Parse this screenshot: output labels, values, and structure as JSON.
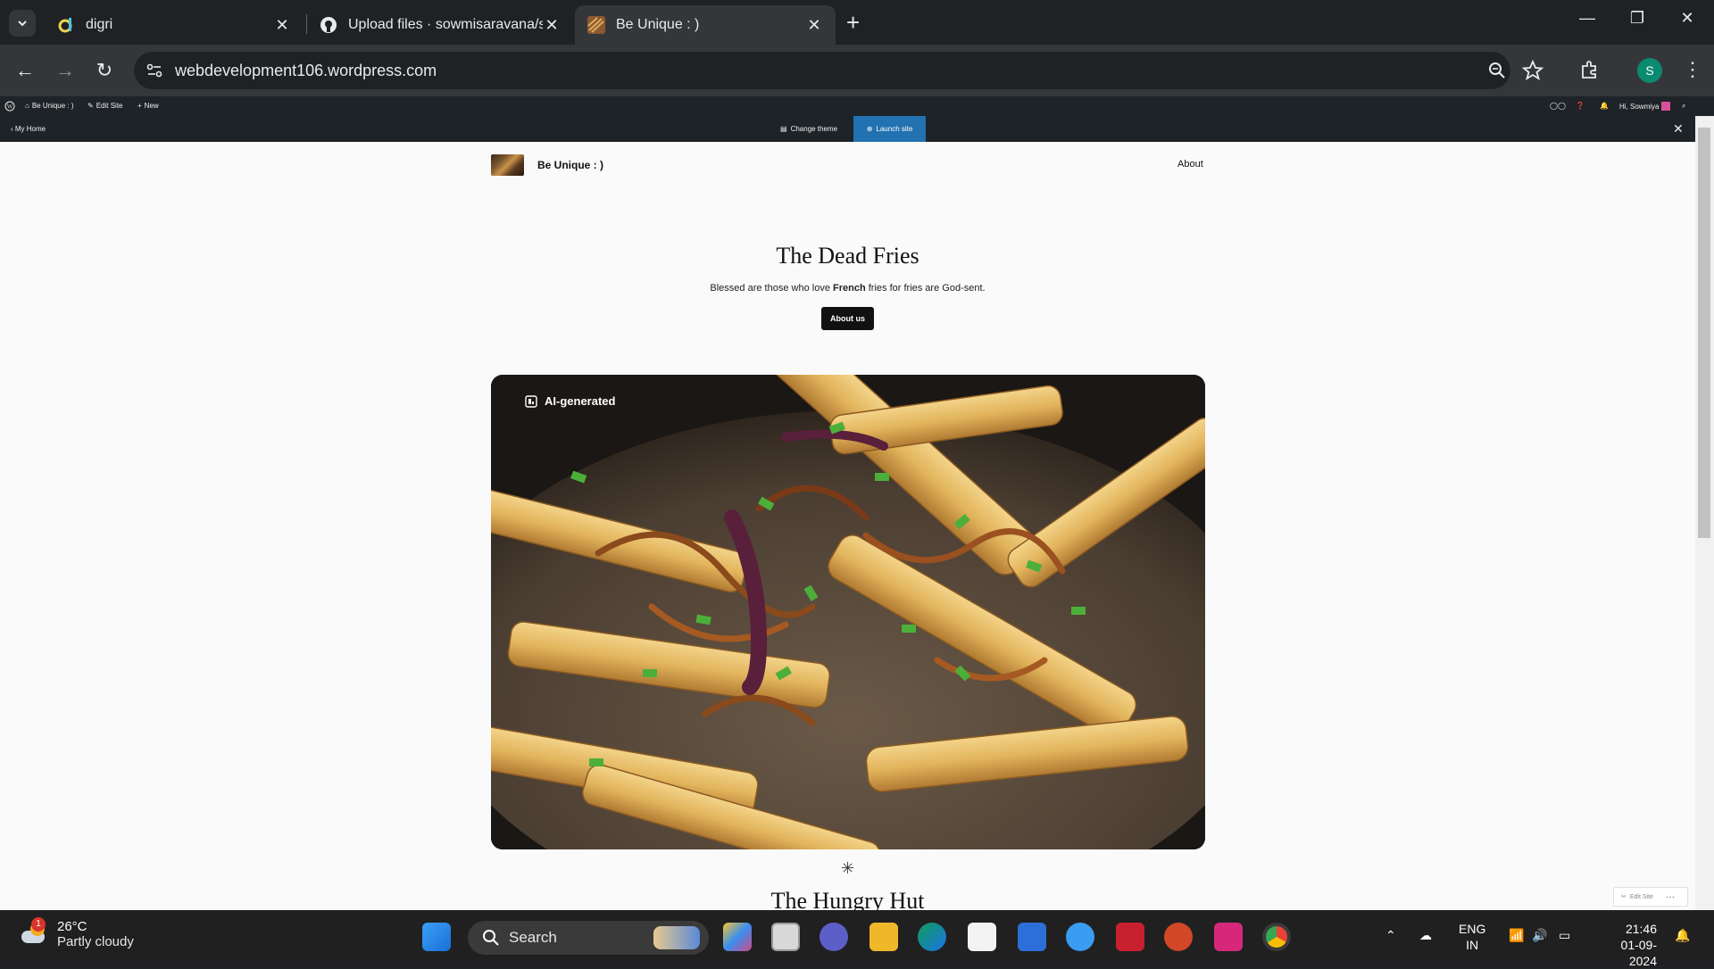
{
  "browser": {
    "tabs": [
      {
        "title": "digri",
        "active": false
      },
      {
        "title": "Upload files · sowmisaravana/sc",
        "active": false
      },
      {
        "title": "Be Unique : )",
        "active": true
      }
    ],
    "url": "webdevelopment106.wordpress.com",
    "profile_initial": "S"
  },
  "wp_admin": {
    "site_name": "Be Unique : )",
    "edit_site": "Edit Site",
    "new": "New",
    "greeting": "Hi, Sowmiya",
    "my_home": "My Home",
    "change_theme": "Change theme",
    "launch_site": "Launch site"
  },
  "site": {
    "title": "Be Unique : )",
    "nav_about": "About",
    "hero_title": "The Dead Fries",
    "hero_text_before": "Blessed are those who love ",
    "hero_text_bold": "French",
    "hero_text_after": " fries for fries are God-sent.",
    "hero_button": "About us",
    "image_badge": "AI-generated",
    "next_title": "The Hungry Hut",
    "edit_site_float": "Edit Site"
  },
  "taskbar": {
    "weather_temp": "26°C",
    "weather_cond": "Partly cloudy",
    "weather_badge": "1",
    "search_label": "Search",
    "lang_top": "ENG",
    "lang_bottom": "IN",
    "time": "21:46",
    "date": "01-09-2024"
  },
  "colors": {
    "launch_blue": "#2271b1",
    "chrome_dark": "#202124",
    "page_bg": "#fafafa"
  }
}
